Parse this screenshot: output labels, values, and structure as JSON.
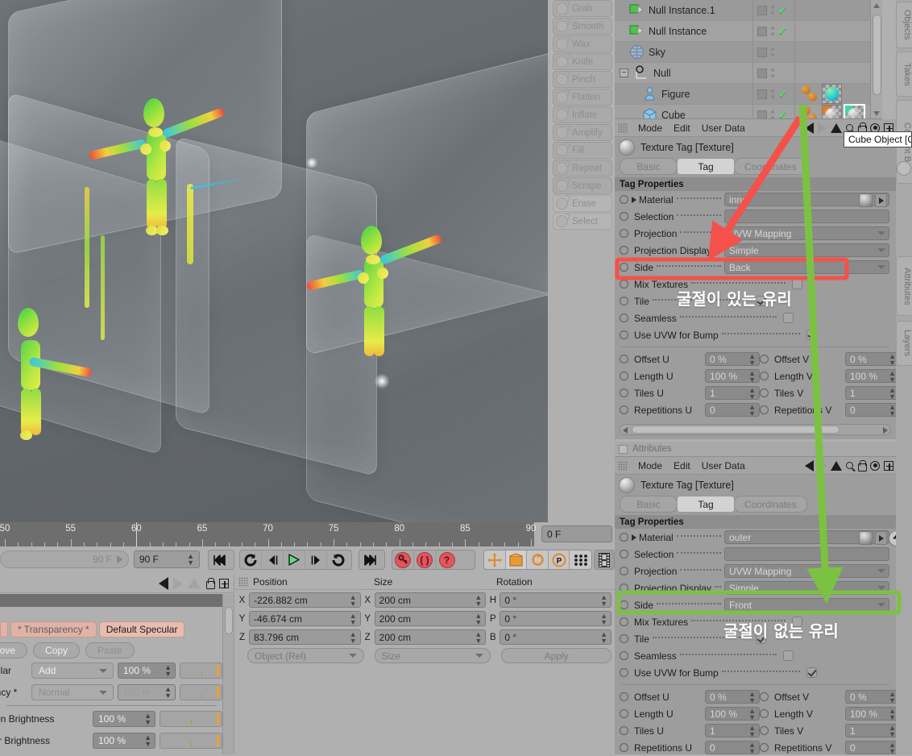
{
  "viewport": {
    "name": "perspective-viewport"
  },
  "sculpt_tools": [
    {
      "label": "Grab"
    },
    {
      "label": "Smooth"
    },
    {
      "label": "Wax"
    },
    {
      "label": "Knife"
    },
    {
      "label": "Pinch"
    },
    {
      "label": "Flatten"
    },
    {
      "label": "Inflate"
    },
    {
      "label": "Amplify"
    },
    {
      "label": "Fill"
    },
    {
      "label": "Repeat"
    },
    {
      "label": "Scrape"
    },
    {
      "label": "Erase"
    },
    {
      "label": "Select"
    }
  ],
  "object_manager": {
    "rows": [
      {
        "label": "Null Instance.1",
        "icon": "null-instance-icon",
        "indent": 1,
        "check": true
      },
      {
        "label": "Null Instance",
        "icon": "null-instance-icon",
        "indent": 1,
        "check": true
      },
      {
        "label": "Sky",
        "icon": "sky-icon",
        "indent": 1,
        "check": false
      },
      {
        "label": "Null",
        "icon": "null-icon",
        "indent": 0,
        "check": false
      },
      {
        "label": "Figure",
        "icon": "figure-icon",
        "indent": 2,
        "check": true
      },
      {
        "label": "Cube",
        "icon": "cube-icon",
        "indent": 2,
        "check": true
      }
    ]
  },
  "tooltip": {
    "text": "Cube Object [C"
  },
  "vertical_tabs": [
    {
      "label": "Objects"
    },
    {
      "label": "Takes"
    },
    {
      "label": "Content B"
    },
    {
      "label": "Attributes"
    },
    {
      "label": "Layers"
    }
  ],
  "attributes_top": {
    "panel_title": "Attributes",
    "menu": [
      "Mode",
      "Edit",
      "User Data"
    ],
    "object_title": "Texture Tag [Texture]",
    "tabs": [
      {
        "label": "Basic",
        "active": false
      },
      {
        "label": "Tag",
        "active": true
      },
      {
        "label": "Coordinates",
        "active": false
      }
    ],
    "group_title": "Tag Properties",
    "properties": [
      {
        "label": "Material",
        "value": "inner",
        "type": "material"
      },
      {
        "label": "Selection",
        "value": "",
        "type": "text"
      },
      {
        "label": "Projection",
        "value": "UVW Mapping",
        "type": "dropdown"
      },
      {
        "label": "Projection Display",
        "value": "Simple",
        "type": "dropdown"
      },
      {
        "label": "Side",
        "value": "Back",
        "type": "dropdown",
        "highlight": "red"
      },
      {
        "label": "Mix Textures",
        "value": false,
        "type": "checkbox"
      },
      {
        "label": "Tile",
        "value": true,
        "type": "checkbox"
      },
      {
        "label": "Seamless",
        "value": false,
        "type": "checkbox"
      },
      {
        "label": "Use UVW for Bump",
        "value": true,
        "type": "checkbox"
      }
    ],
    "uv_grid": [
      {
        "label_l": "Offset U",
        "value_l": "0 %",
        "label_r": "Offset V",
        "value_r": "0 %"
      },
      {
        "label_l": "Length U",
        "value_l": "100 %",
        "label_r": "Length V",
        "value_r": "100 %"
      },
      {
        "label_l": "Tiles U",
        "value_l": "1",
        "label_r": "Tiles V",
        "value_r": "1"
      },
      {
        "label_l": "Repetitions U",
        "value_l": "0",
        "label_r": "Repetitions V",
        "value_r": "0"
      }
    ]
  },
  "attributes_bottom": {
    "panel_title": "Attributes",
    "menu": [
      "Mode",
      "Edit",
      "User Data"
    ],
    "object_title": "Texture Tag [Texture]",
    "tabs": [
      {
        "label": "Basic",
        "active": false
      },
      {
        "label": "Tag",
        "active": true
      },
      {
        "label": "Coordinates",
        "active": false
      }
    ],
    "group_title": "Tag Properties",
    "properties": [
      {
        "label": "Material",
        "value": "outer",
        "type": "material"
      },
      {
        "label": "Selection",
        "value": "",
        "type": "text"
      },
      {
        "label": "Projection",
        "value": "UVW Mapping",
        "type": "dropdown"
      },
      {
        "label": "Projection Display",
        "value": "Simple",
        "type": "dropdown"
      },
      {
        "label": "Side",
        "value": "Front",
        "type": "dropdown",
        "highlight": "green"
      },
      {
        "label": "Mix Textures",
        "value": false,
        "type": "checkbox"
      },
      {
        "label": "Tile",
        "value": true,
        "type": "checkbox"
      },
      {
        "label": "Seamless",
        "value": false,
        "type": "checkbox"
      },
      {
        "label": "Use UVW for Bump",
        "value": true,
        "type": "checkbox"
      }
    ],
    "uv_grid": [
      {
        "label_l": "Offset U",
        "value_l": "0 %",
        "label_r": "Offset V",
        "value_r": "0 %"
      },
      {
        "label_l": "Length U",
        "value_l": "100 %",
        "label_r": "Length V",
        "value_r": "100 %"
      },
      {
        "label_l": "Tiles U",
        "value_l": "1",
        "label_r": "Tiles V",
        "value_r": "1"
      },
      {
        "label_l": "Repetitions U",
        "value_l": "0",
        "label_r": "Repetitions V",
        "value_r": "0"
      }
    ]
  },
  "annotations": {
    "red_label": "굴절이 있는 유리",
    "green_label": "굴절이 없는 유리",
    "red_color": "#f4514a",
    "green_color": "#7cc242"
  },
  "timeline": {
    "ticks": [
      50,
      55,
      60,
      65,
      70,
      75,
      80,
      85,
      90
    ],
    "current_frame_field": "0 F",
    "range_field": "90 F",
    "end_field": "90 F"
  },
  "coordinates": {
    "headers": [
      "Position",
      "Size",
      "Rotation"
    ],
    "position": [
      {
        "axis": "X",
        "value": "-226.882 cm"
      },
      {
        "axis": "Y",
        "value": "-46.674 cm"
      },
      {
        "axis": "Z",
        "value": "83.796 cm"
      }
    ],
    "size": [
      {
        "axis": "X",
        "value": "200 cm"
      },
      {
        "axis": "Y",
        "value": "200 cm"
      },
      {
        "axis": "Z",
        "value": "200 cm"
      }
    ],
    "rotation": [
      {
        "axis": "H",
        "value": "0 °"
      },
      {
        "axis": "P",
        "value": "0 °"
      },
      {
        "axis": "B",
        "value": "0 °"
      }
    ],
    "mode_select": "Object (Rel)",
    "size_select": "Size",
    "apply_button": "Apply"
  },
  "material_editor": {
    "tabs": [
      {
        "label": "* Transparency *",
        "style": "pink"
      },
      {
        "label": "Default Specular",
        "style": "pinkdk"
      }
    ],
    "buttons": [
      {
        "label": "nove",
        "dim": false
      },
      {
        "label": "Copy",
        "dim": false
      },
      {
        "label": "Paste",
        "dim": true
      }
    ],
    "rows": [
      {
        "label": "cular",
        "select": "Add",
        "value": "100 %",
        "dim": false
      },
      {
        "label": "ency *",
        "select": "Normal",
        "value": "100 %",
        "dim": true
      }
    ],
    "brightness_rows": [
      {
        "label": "ction Brightness",
        "value": "100 %"
      },
      {
        "label": "ular Brightness",
        "value": "100 %"
      }
    ]
  }
}
